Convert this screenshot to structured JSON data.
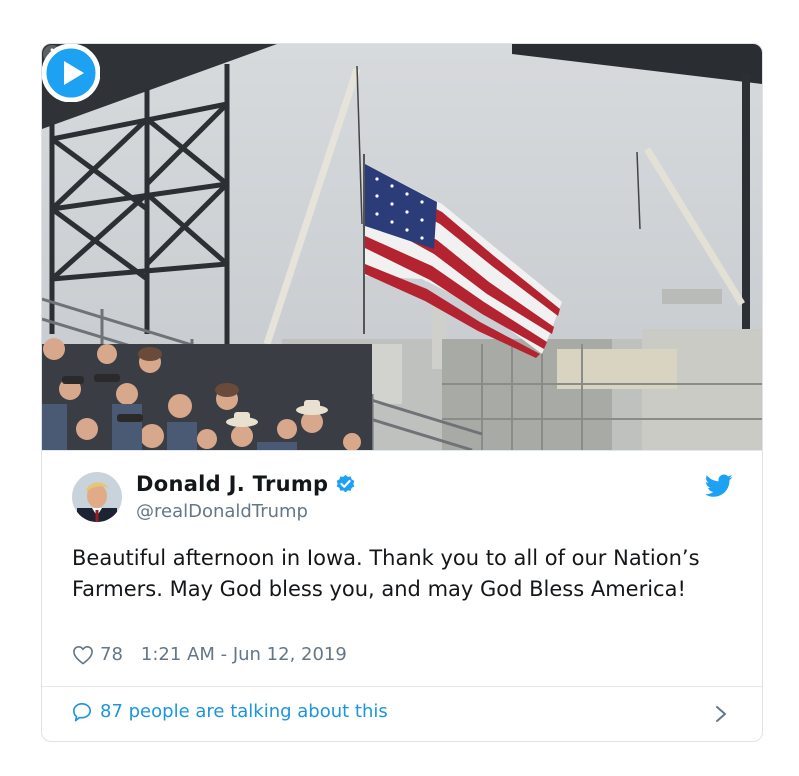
{
  "tweet": {
    "name": "Donald J. Trump",
    "handle": "@realDonaldTrump",
    "text": "Beautiful afternoon in Iowa. Thank you to all of our Nation’s Farmers. May God bless you, and may God Bless America!",
    "likes": "78",
    "timestamp": "1:21 AM - Jun 12, 2019",
    "talking": "87 people are talking about this"
  },
  "icons": {
    "info": "info-icon",
    "play": "play-icon",
    "verified": "verified-badge-icon",
    "bird": "twitter-bird-icon",
    "heart": "heart-icon",
    "bubble": "speech-bubble-icon",
    "chevron": "chevron-right-icon"
  },
  "colors": {
    "accent": "#1da1f2",
    "link": "#1b95e0",
    "muted": "#657786"
  }
}
